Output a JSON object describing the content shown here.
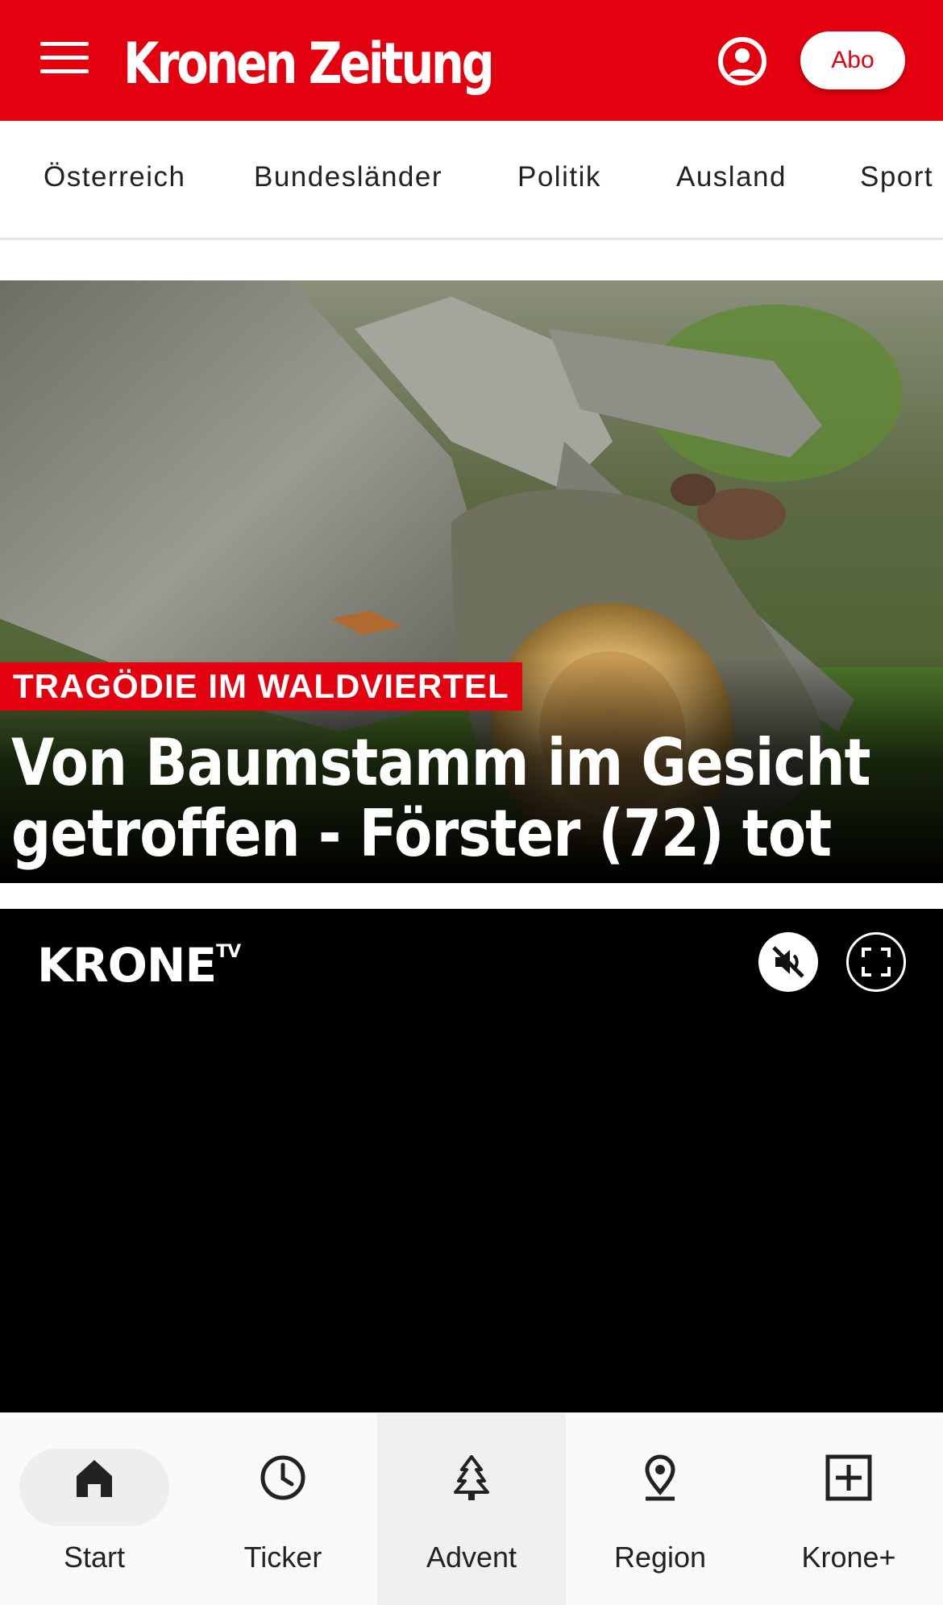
{
  "header": {
    "brand": "Kronen Zeitung",
    "abo_label": "Abo",
    "brand_color": "#e3000f"
  },
  "categories": [
    "Österreich",
    "Bundesländer",
    "Politik",
    "Ausland",
    "Sport"
  ],
  "hero": {
    "kicker": "TRAGÖDIE IM WALDVIERTEL",
    "headline": "Von Baumstamm im Gesicht getroffen - Förster (72) tot"
  },
  "video": {
    "brand": "KRONE",
    "brand_superscript": "TV"
  },
  "bottom_nav": {
    "items": [
      {
        "label": "Start",
        "icon": "home-icon"
      },
      {
        "label": "Ticker",
        "icon": "clock-icon"
      },
      {
        "label": "Advent",
        "icon": "tree-icon"
      },
      {
        "label": "Region",
        "icon": "location-pin-icon"
      },
      {
        "label": "Krone+",
        "icon": "plus-box-icon"
      }
    ]
  }
}
